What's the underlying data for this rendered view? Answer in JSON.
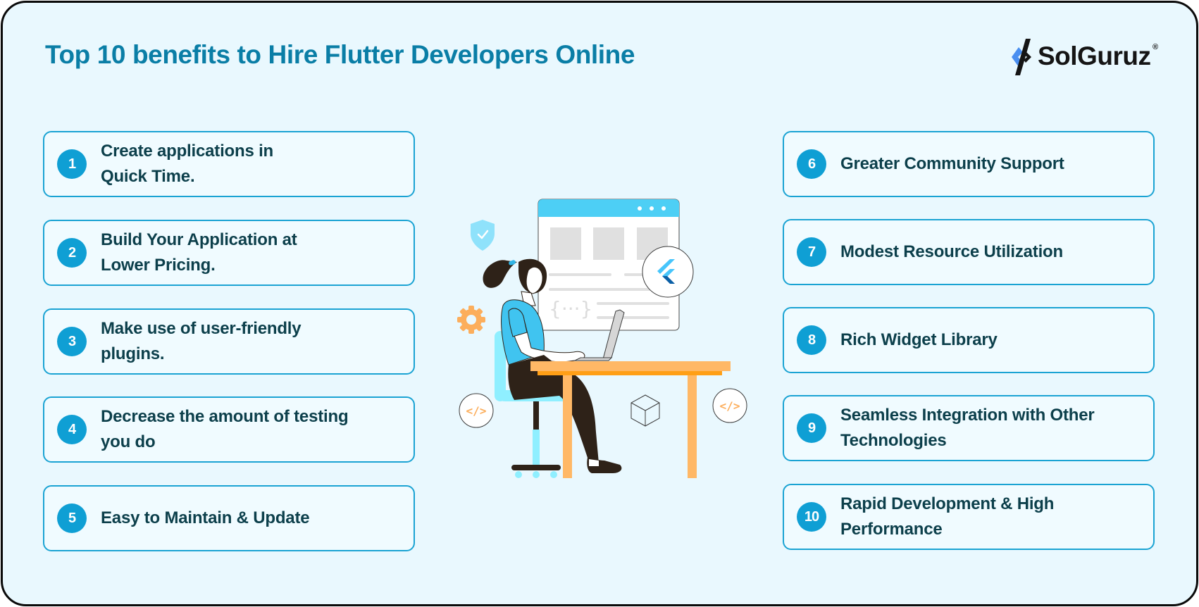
{
  "title": "Top 10 benefits to Hire Flutter Developers Online",
  "brand": {
    "name": "SolGuruz",
    "registered_mark": "®",
    "colors": {
      "mark_blue": "#4a8ff0",
      "mark_dark": "#151515"
    }
  },
  "colors": {
    "background": "#e9f8fe",
    "title": "#0a7ea6",
    "card_border": "#1aa3d3",
    "badge": "#0f9fd4",
    "card_text": "#0c3f4b"
  },
  "benefits_left": [
    {
      "number": "1",
      "lines": [
        "Create applications in",
        "Quick Time."
      ]
    },
    {
      "number": "2",
      "lines": [
        "Build Your Application at",
        "Lower Pricing."
      ]
    },
    {
      "number": "3",
      "lines": [
        "Make use of user-friendly",
        "plugins."
      ]
    },
    {
      "number": "4",
      "lines": [
        "Decrease the amount of testing",
        "you do"
      ]
    },
    {
      "number": "5",
      "lines": [
        "Easy to Maintain & Update"
      ]
    }
  ],
  "benefits_right": [
    {
      "number": "6",
      "lines": [
        "Greater Community Support"
      ]
    },
    {
      "number": "7",
      "lines": [
        "Modest Resource Utilization"
      ]
    },
    {
      "number": "8",
      "lines": [
        "Rich Widget Library"
      ]
    },
    {
      "number": "9",
      "lines": [
        "Seamless Integration with Other",
        "Technologies"
      ]
    },
    {
      "number": "10",
      "lines": [
        "Rapid Development & High",
        "Performance"
      ]
    }
  ],
  "illustration": {
    "icons": [
      "shield-check-icon",
      "gear-icon",
      "code-tag-icon",
      "cube-icon",
      "flutter-logo-icon",
      "browser-window",
      "laptop",
      "developer-person",
      "desk",
      "office-chair"
    ],
    "code_placeholder": "{···}",
    "code_tag": "</>"
  }
}
